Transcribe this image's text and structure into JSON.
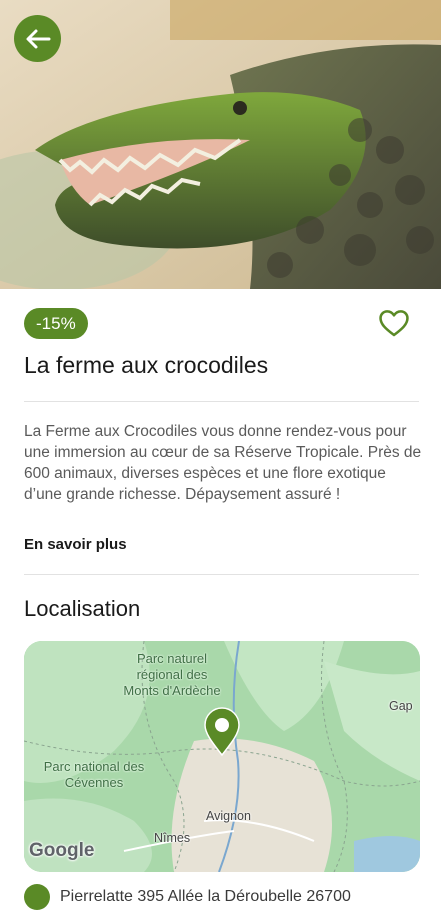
{
  "hero": {
    "image_alt": "Crocodile photo"
  },
  "header": {
    "back_icon": "arrow-left-icon"
  },
  "badge": {
    "discount": "-15%"
  },
  "favorite": {
    "icon": "heart-outline-icon"
  },
  "attraction": {
    "title": "La ferme aux crocodiles",
    "description": "La Ferme aux Crocodiles vous donne rendez-vous pour une immersion au cœur de sa Réserve Tropicale. Près de 600 animaux, diverses espèces et une flore exotique d’une grande richesse. Dépaysement assuré !",
    "more_link": "En savoir plus"
  },
  "location": {
    "section_title": "Localisation",
    "map": {
      "labels": {
        "parc_ardeche": "Parc naturel régional des Monts d'Ardèche",
        "parc_cevennes": "Parc national des Cévennes",
        "gap": "Gap",
        "avignon": "Avignon",
        "nimes": "Nîmes"
      },
      "attribution": "Google",
      "pin_icon": "map-pin-icon"
    },
    "address": "Pierrelatte 395 Allée la Déroubelle 26700"
  },
  "colors": {
    "accent": "#5a8a26",
    "map_green": "#a6d7a9"
  }
}
